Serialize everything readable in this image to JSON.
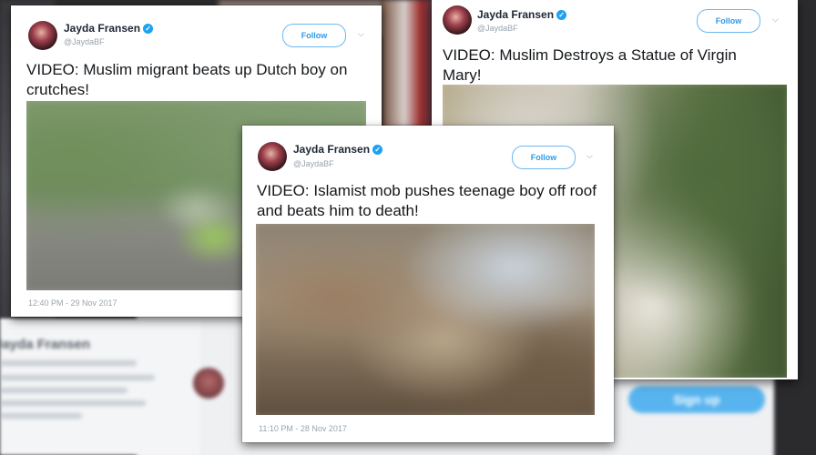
{
  "tweets": [
    {
      "user": "Jayda Fransen",
      "handle": "@JaydaBF",
      "follow_label": "Follow",
      "text": "VIDEO: Muslim migrant beats up Dutch boy on crutches!",
      "timestamp": "12:40 PM - 29 Nov 2017"
    },
    {
      "user": "Jayda Fransen",
      "handle": "@JaydaBF",
      "follow_label": "Follow",
      "text": "VIDEO: Muslim Destroys a Statue of Virgin Mary!"
    },
    {
      "user": "Jayda Fransen",
      "handle": "@JaydaBF",
      "follow_label": "Follow",
      "text": "VIDEO: Islamist mob pushes teenage boy off roof and beats him to death!",
      "timestamp": "11:10 PM - 28 Nov 2017"
    }
  ],
  "background": {
    "profile_name": "Jayda Fransen",
    "signup_label": "Sign up"
  },
  "colors": {
    "accent": "#1da1f2",
    "text": "#14171a",
    "muted": "#9aa5af"
  }
}
